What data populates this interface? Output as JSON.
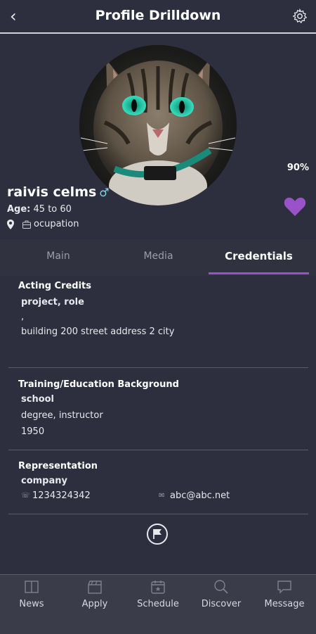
{
  "header": {
    "title": "Profile Drilldown"
  },
  "profile": {
    "completion": "90%",
    "name": "raivis celms",
    "gender_symbol": "♂",
    "age_label": "Age:",
    "age_value": "45 to 60",
    "occupation": "ocupation"
  },
  "tabs": [
    {
      "label": "Main"
    },
    {
      "label": "Media"
    },
    {
      "label": "Credentials"
    }
  ],
  "acting": {
    "title": "Acting Credits",
    "project": "project, role",
    "line2": ",",
    "address": "building 200 street address 2 city"
  },
  "training": {
    "title": "Training/Education Background",
    "school": "school",
    "degree": "degree, instructor",
    "year": "1950"
  },
  "representation": {
    "title": "Representation",
    "company": "company",
    "phone": "1234324342",
    "email": "abc@abc.net"
  },
  "nav": [
    {
      "label": "News",
      "icon": "book-icon"
    },
    {
      "label": "Apply",
      "icon": "clapper-icon"
    },
    {
      "label": "Schedule",
      "icon": "calendar-icon"
    },
    {
      "label": "Discover",
      "icon": "search-icon"
    },
    {
      "label": "Message",
      "icon": "chat-icon"
    }
  ],
  "colors": {
    "accent": "#9a52c8",
    "background": "#2d2f3e",
    "gender": "#7fd6ef"
  }
}
